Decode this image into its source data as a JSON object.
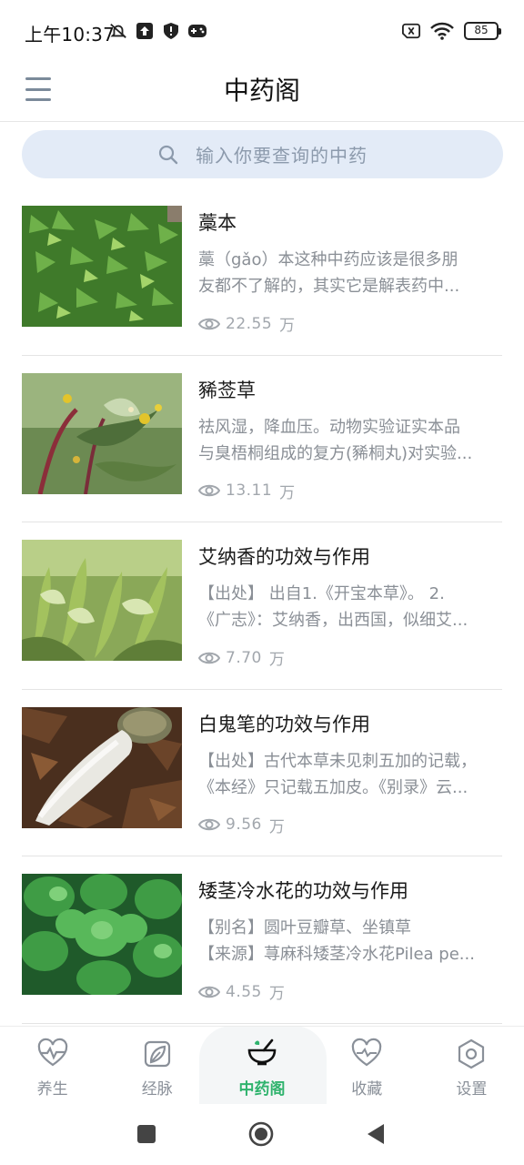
{
  "status_bar": {
    "time": "上午10:37",
    "battery": "85",
    "icons_left": [
      "mute-bell-icon",
      "upload-icon",
      "shield-icon",
      "gamepad-icon"
    ],
    "icons_right": [
      "sim-off-icon",
      "wifi-icon",
      "battery-icon"
    ]
  },
  "header": {
    "title": "中药阁",
    "menu_icon": "hamburger-menu-icon"
  },
  "search": {
    "placeholder": "输入你要查询的中药"
  },
  "items": [
    {
      "title": "藁本",
      "desc_line1": "藁（gǎo）本这种中药应该是很多朋",
      "desc_line2": "友都不了解的，其实它是解表药中...",
      "views": "22.55",
      "unit": "万",
      "image": "fern-plant"
    },
    {
      "title": "豨莶草",
      "desc_line1": "祛风湿，降血压。动物实验证实本品",
      "desc_line2": "与臭梧桐组成的复方(豨桐丸)对实验...",
      "views": "13.11",
      "unit": "万",
      "image": "yellow-flower-plant"
    },
    {
      "title": "艾纳香的功效与作用",
      "desc_line1": "【出处】 出自1.《开宝本草》。 2.",
      "desc_line2": "《广志》：艾纳香，出西国，似细艾...",
      "views": "7.70",
      "unit": "万",
      "image": "leafy-herb"
    },
    {
      "title": "白鬼笔的功效与作用",
      "desc_line1": "【出处】古代本草未见刺五加的记载，",
      "desc_line2": "《本经》只记载五加皮。《别录》云...",
      "views": "9.56",
      "unit": "万",
      "image": "white-mushroom"
    },
    {
      "title": "矮茎冷水花的功效与作用",
      "desc_line1": "【别名】圆叶豆瓣草、坐镇草",
      "desc_line2": "【来源】荨麻科矮茎冷水花Pilea pe...",
      "views": "4.55",
      "unit": "万",
      "image": "round-leaf-plant"
    }
  ],
  "bottom_nav": [
    {
      "label": "养生",
      "icon": "heartbeat-icon",
      "active": false
    },
    {
      "label": "经脉",
      "icon": "leaf-icon",
      "active": false
    },
    {
      "label": "中药阁",
      "icon": "mortar-pestle-icon",
      "active": true
    },
    {
      "label": "收藏",
      "icon": "heart-pulse-icon",
      "active": false
    },
    {
      "label": "设置",
      "icon": "hexagon-settings-icon",
      "active": false
    }
  ],
  "colors": {
    "accent": "#2fb36d",
    "search_bg": "#e3ebf7",
    "text_secondary": "#8a8f96"
  }
}
